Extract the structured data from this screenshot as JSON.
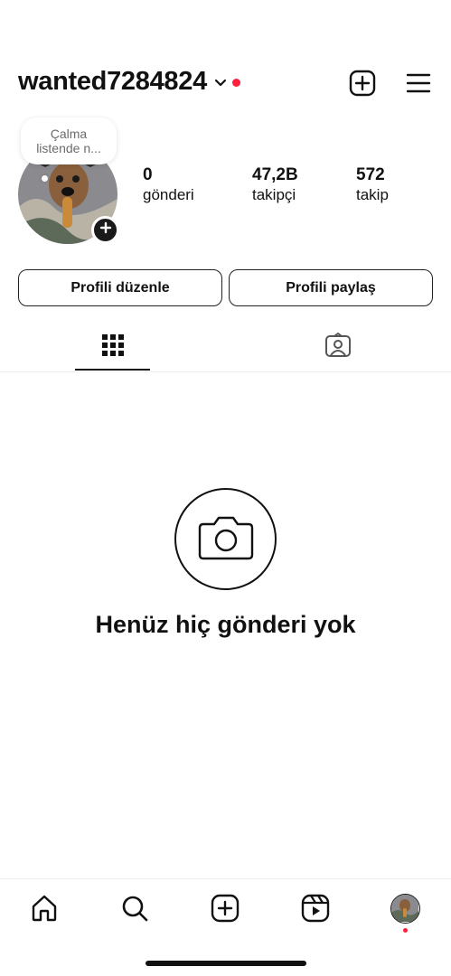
{
  "header": {
    "username": "wanted7284824",
    "icons": {
      "dropdown": "chevron-down-icon",
      "add": "plus-square-icon",
      "menu": "hamburger-menu-icon"
    },
    "notification_dot_color": "#ff1f3d"
  },
  "note": {
    "text_line1": "Çalma",
    "text_line2": "listende n..."
  },
  "profile": {
    "avatar_icon": "profile-photo",
    "add_story_icon": "plus-icon",
    "stats": [
      {
        "value": "0",
        "label": "gönderi"
      },
      {
        "value": "47,2B",
        "label": "takipçi"
      },
      {
        "value": "572",
        "label": "takip"
      }
    ]
  },
  "actions": {
    "edit_profile": "Profili düzenle",
    "share_profile": "Profili paylaş"
  },
  "tabs": [
    {
      "icon": "grid-icon",
      "active": true
    },
    {
      "icon": "tagged-person-icon",
      "active": false
    }
  ],
  "empty_state": {
    "icon": "camera-icon",
    "title": "Henüz hiç gönderi yok"
  },
  "bottom_nav": [
    {
      "icon": "home-icon"
    },
    {
      "icon": "search-icon"
    },
    {
      "icon": "create-post-icon"
    },
    {
      "icon": "reels-icon"
    },
    {
      "icon": "profile-avatar-icon"
    }
  ],
  "colors": {
    "accent_red": "#ff1f3d",
    "text": "#111111",
    "muted": "#6b6b6b",
    "border": "#efefef"
  }
}
